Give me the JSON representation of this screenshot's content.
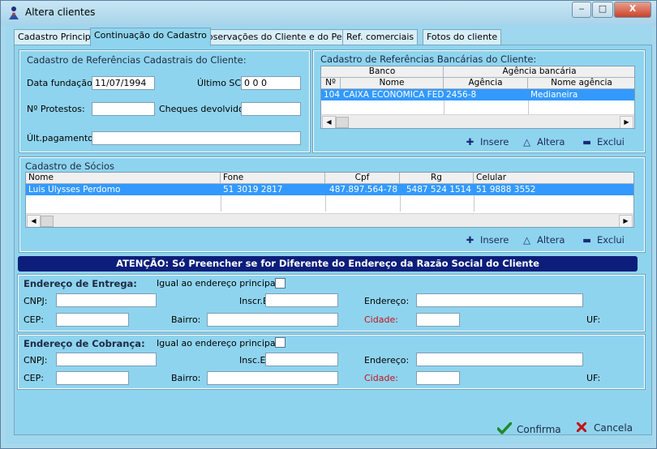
{
  "window": {
    "title": "Altera clientes",
    "controls": {
      "minimize": "‒",
      "maximize": "□",
      "close": "X"
    }
  },
  "tabs": [
    {
      "label": "Cadastro Principal",
      "active": false
    },
    {
      "label": "Continuação do Cadastro",
      "active": true
    },
    {
      "label": "Observações do Cliente e do Pedido",
      "active": false
    },
    {
      "label": "Ref. comerciais",
      "active": false
    },
    {
      "label": "Fotos do cliente",
      "active": false
    }
  ],
  "ref_cadastrais": {
    "title": "Cadastro de Referências Cadastrais do Cliente:",
    "data_fundacao_label": "Data fundação:",
    "data_fundacao_value": "11/07/1994",
    "ultimo_sci_label": "Último SCI:",
    "ultimo_sci_value": "0 0  0",
    "protestos_label": "Nº Protestos:",
    "protestos_value": "",
    "cheques_label": "Cheques devolvidos:",
    "cheques_value": "",
    "ult_pagamentos_label": "Últ.pagamentos:",
    "ult_pagamentos_value": ""
  },
  "ref_bancarias": {
    "title": "Cadastro de Referências Bancárias do Cliente:",
    "group_headers": {
      "banco": "Banco",
      "agencia": "Agência bancária"
    },
    "columns": [
      "Nº",
      "Nome",
      "Agência",
      "Nome agência"
    ],
    "rows": [
      {
        "numero": "104",
        "nome": "CAIXA ECONOMICA FED",
        "agencia": "2456-8",
        "nome_agencia": "Medianeira"
      }
    ],
    "actions": {
      "insere": "Insere",
      "altera": "Altera",
      "exclui": "Exclui"
    }
  },
  "socios": {
    "title": "Cadastro de Sócios",
    "columns": [
      "Nome",
      "Fone",
      "Cpf",
      "Rg",
      "Celular"
    ],
    "rows": [
      {
        "nome": "Luis Ulysses Perdomo",
        "fone": "51 3019 2817",
        "cpf": "487.897.564-78",
        "rg": "5487 524 1514",
        "celular": "51 9888 3552"
      }
    ],
    "actions": {
      "insere": "Insere",
      "altera": "Altera",
      "exclui": "Exclui"
    }
  },
  "banner": "ATENÇÃO:  Só Preencher se for Diferente do Endereço da Razão Social do Cliente",
  "entrega": {
    "title": "Endereço de Entrega:",
    "igual_label": "Igual ao endereço principal?",
    "cnpj_label": "CNPJ:",
    "inscr_label": "Inscr.Est.:",
    "endereco_label": "Endereço:",
    "cep_label": "CEP:",
    "bairro_label": "Bairro:",
    "cidade_label": "Cidade:",
    "uf_label": "UF:"
  },
  "cobranca": {
    "title": "Endereço de Cobrança:",
    "igual_label": "Igual ao endereço principal?",
    "cnpj_label": "CNPJ:",
    "inscr_label": "Insc.Est.:",
    "endereco_label": "Endereço:",
    "cep_label": "CEP:",
    "bairro_label": "Bairro:",
    "cidade_label": "Cidade:",
    "uf_label": "UF:"
  },
  "footer": {
    "confirma": "Confirma",
    "cancela": "Cancela"
  },
  "colors": {
    "accent": "#0c1e7a",
    "selection": "#3399ff",
    "required_label": "#c4121a",
    "panel": "#8fd4ee"
  },
  "icons": {
    "insere": "plus-icon",
    "altera": "triangle-icon",
    "exclui": "minus-icon",
    "confirma": "checkmark-icon",
    "cancela": "x-icon"
  }
}
